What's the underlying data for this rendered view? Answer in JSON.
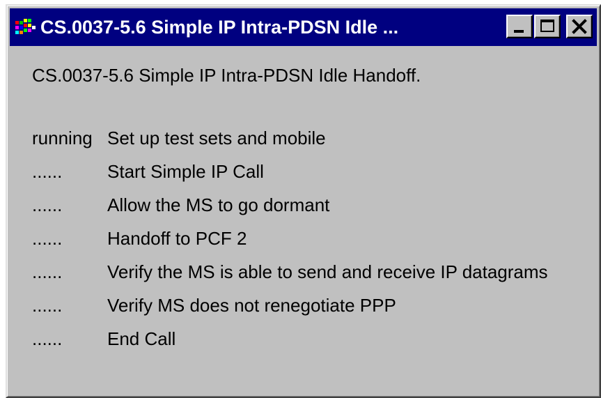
{
  "window": {
    "title": "CS.0037-5.6 Simple IP Intra-PDSN Idle ...",
    "app_icon": "app-grid-icon",
    "buttons": {
      "minimize": "minimize-icon",
      "maximize": "maximize-icon",
      "close": "close-icon"
    }
  },
  "content": {
    "heading": "CS.0037-5.6 Simple IP Intra-PDSN Idle Handoff.",
    "steps": [
      {
        "status": "running",
        "label": "Set up test sets and mobile"
      },
      {
        "status": "......",
        "label": "Start Simple IP Call"
      },
      {
        "status": "......",
        "label": "Allow the MS to go dormant"
      },
      {
        "status": "......",
        "label": "Handoff to PCF 2"
      },
      {
        "status": "......",
        "label": "Verify the MS is able to send and receive IP datagrams"
      },
      {
        "status": "......",
        "label": "Verify MS does not renegotiate PPP"
      },
      {
        "status": "......",
        "label": "End Call"
      }
    ]
  },
  "colors": {
    "titlebar": "#000080",
    "window_face": "#c0c0c0"
  }
}
